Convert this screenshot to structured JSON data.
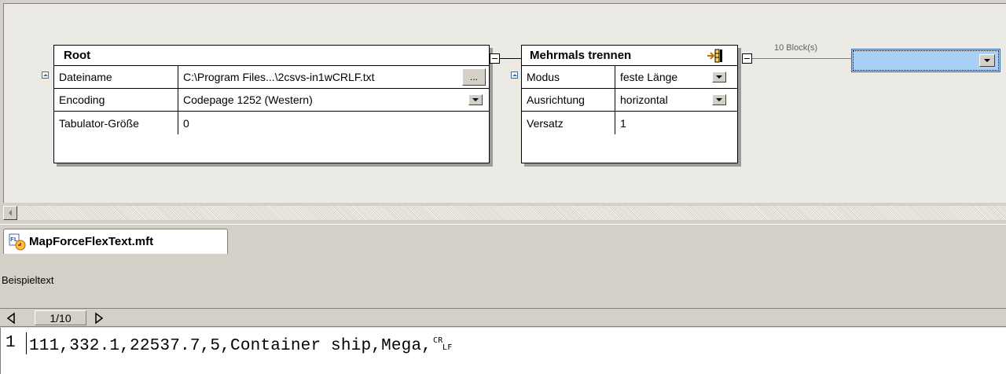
{
  "root_component": {
    "title": "Root",
    "rows": [
      {
        "label": "Dateiname",
        "value": "C:\\Program Files...\\2csvs-in1wCRLF.txt",
        "control": "..."
      },
      {
        "label": "Encoding",
        "value": "Codepage 1252 (Western)"
      },
      {
        "label": "Tabulator-Größe",
        "value": "0"
      }
    ]
  },
  "split_component": {
    "title": "Mehrmals trennen",
    "rows": [
      {
        "label": "Modus",
        "value": "feste Länge"
      },
      {
        "label": "Ausrichtung",
        "value": "horizontal"
      },
      {
        "label": "Versatz",
        "value": "1"
      }
    ]
  },
  "connector_label": "10 Block(s)",
  "tab": {
    "title": "MapForceFlexText.mft"
  },
  "sample_text_label": "Beispieltext",
  "pager": {
    "current": "1/10"
  },
  "editor": {
    "line_number": "1",
    "text": "111,332.1,22537.7,5,Container ship,Mega,"
  },
  "colors": {
    "canvas": "#ebeae4",
    "selected_box": "#aad0f8",
    "selected_border": "#3a6ea5"
  }
}
